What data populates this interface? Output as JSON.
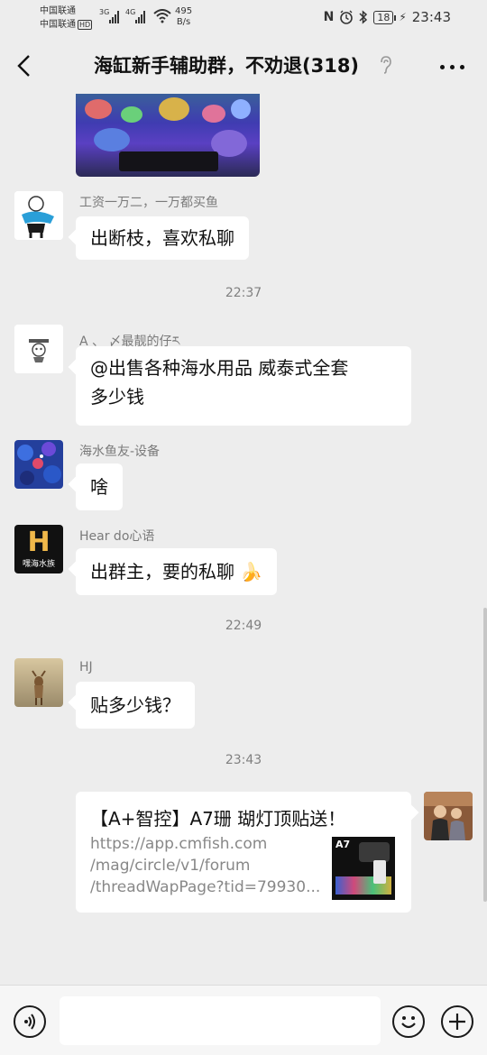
{
  "status_bar": {
    "carrier1": "中国联通",
    "carrier2": "中国联通",
    "hd_badge": "HD",
    "net1": "3G",
    "net2": "4G",
    "speed_value": "495",
    "speed_unit": "B/s",
    "nfc": "N",
    "battery": "18",
    "time": "23:43"
  },
  "header": {
    "title": "海缸新手辅助群，不劝退(318)",
    "icons": [
      "back-arrow-icon",
      "ear-icon",
      "more-dots-icon"
    ]
  },
  "messages": [
    {
      "sender": "工资一万二，一万都买鱼",
      "text": "出断枝，喜欢私聊"
    },
    {
      "time": "22:37"
    },
    {
      "sender": "A  、    〆最靓的仔ར",
      "text_line1": "@出售各种海水用品  威泰式全套",
      "text_line2": "多少钱"
    },
    {
      "sender": "海水鱼友-设备",
      "text": "啥"
    },
    {
      "sender": "Hear do心语",
      "text": "出群主，要的私聊",
      "emoji": "🍌"
    },
    {
      "time": "22:49"
    },
    {
      "sender": "HJ",
      "text": "贴多少钱？"
    },
    {
      "time": "23:43"
    },
    {
      "link": {
        "title": "【A+智控】A7珊 瑚灯顶贴送！",
        "desc1": "https://app.cmfish.com",
        "desc2": "/mag/circle/v1/forum",
        "desc3": "/threadWapPage?tid=79930...",
        "thumb_label": "A7"
      }
    }
  ],
  "avatar_texts": {
    "hear_do_logo": "H",
    "hear_do_brand": "嘿海水族"
  },
  "input_bar": {
    "icons": [
      "voice-icon",
      "emoji-icon",
      "plus-icon"
    ],
    "placeholder": ""
  },
  "colors": {
    "background": "#ededed",
    "bubble": "#ffffff",
    "banana": "#f2c230"
  }
}
